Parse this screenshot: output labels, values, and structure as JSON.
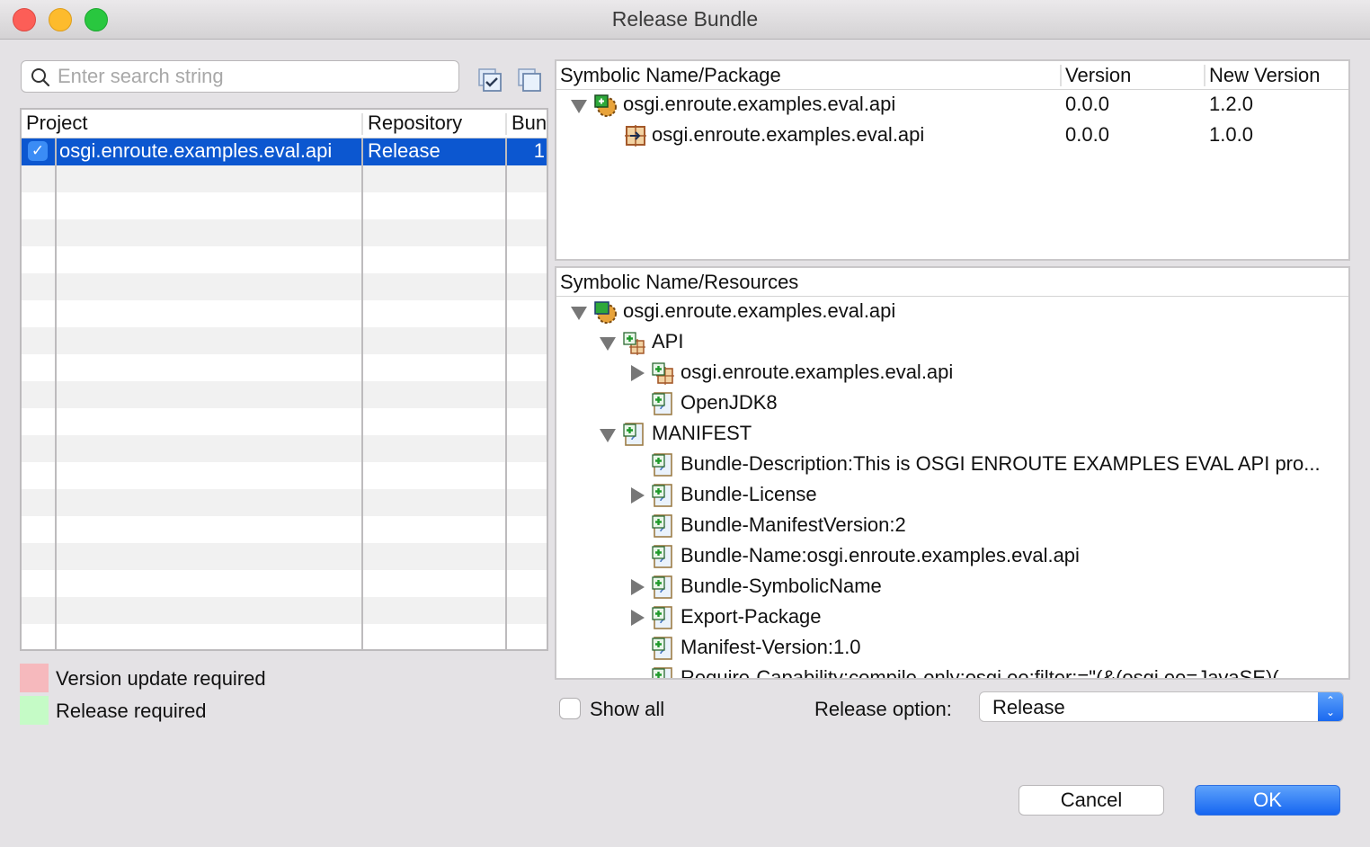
{
  "window": {
    "title": "Release Bundle",
    "controls": [
      "close",
      "minimize",
      "maximize"
    ]
  },
  "search": {
    "placeholder": "Enter search string",
    "value": "",
    "icon": "search-icon"
  },
  "toolbar": {
    "check_all_icon": "check-all-icon",
    "uncheck_all_icon": "uncheck-all-icon"
  },
  "projects_table": {
    "columns": [
      "Project",
      "Repository",
      "Bun"
    ],
    "rows": [
      {
        "checked": true,
        "project": "osgi.enroute.examples.eval.api",
        "repository": "Release",
        "bundles": "1",
        "selected": true
      }
    ]
  },
  "legend": [
    {
      "label": "Version update required",
      "color": "#f6b9bd"
    },
    {
      "label": "Release required",
      "color": "#c5fbc6"
    }
  ],
  "package_tree": {
    "columns": [
      "Symbolic Name/Package",
      "Version",
      "New Version"
    ],
    "rows": [
      {
        "level": 0,
        "expanded": true,
        "icon": "bundle-icon",
        "name": "osgi.enroute.examples.eval.api",
        "version": "0.0.0",
        "new_version": "1.2.0"
      },
      {
        "level": 1,
        "expanded": null,
        "icon": "package-icon",
        "name": "osgi.enroute.examples.eval.api",
        "version": "0.0.0",
        "new_version": "1.0.0"
      }
    ]
  },
  "resources_tree": {
    "header": "Symbolic Name/Resources",
    "rows": [
      {
        "level": 0,
        "twisty": "down",
        "icon": "bundle-icon",
        "label": "osgi.enroute.examples.eval.api"
      },
      {
        "level": 1,
        "twisty": "down",
        "icon": "api-icon",
        "label": "API"
      },
      {
        "level": 2,
        "twisty": "right",
        "icon": "package-icon",
        "label": "osgi.enroute.examples.eval.api"
      },
      {
        "level": 2,
        "twisty": null,
        "icon": "file-icon",
        "label": "OpenJDK8"
      },
      {
        "level": 1,
        "twisty": "down",
        "icon": "file-icon",
        "label": "MANIFEST"
      },
      {
        "level": 2,
        "twisty": null,
        "icon": "file-icon",
        "label": "Bundle-Description:This is OSGI ENROUTE EXAMPLES EVAL API pro..."
      },
      {
        "level": 2,
        "twisty": "right",
        "icon": "file-icon",
        "label": "Bundle-License"
      },
      {
        "level": 2,
        "twisty": null,
        "icon": "file-icon",
        "label": "Bundle-ManifestVersion:2"
      },
      {
        "level": 2,
        "twisty": null,
        "icon": "file-icon",
        "label": "Bundle-Name:osgi.enroute.examples.eval.api"
      },
      {
        "level": 2,
        "twisty": "right",
        "icon": "file-icon",
        "label": "Bundle-SymbolicName"
      },
      {
        "level": 2,
        "twisty": "right",
        "icon": "file-icon",
        "label": "Export-Package"
      },
      {
        "level": 2,
        "twisty": null,
        "icon": "file-icon",
        "label": "Manifest-Version:1.0"
      },
      {
        "level": 2,
        "twisty": null,
        "icon": "file-icon",
        "label": "Require-Capability:compile-only;osgi.ee;filter:=\"(&(osgi.ee=JavaSE)("
      }
    ]
  },
  "options": {
    "show_all_label": "Show all",
    "show_all_checked": false,
    "release_option_label": "Release option:",
    "release_option_value": "Release"
  },
  "buttons": {
    "cancel": "Cancel",
    "ok": "OK"
  }
}
